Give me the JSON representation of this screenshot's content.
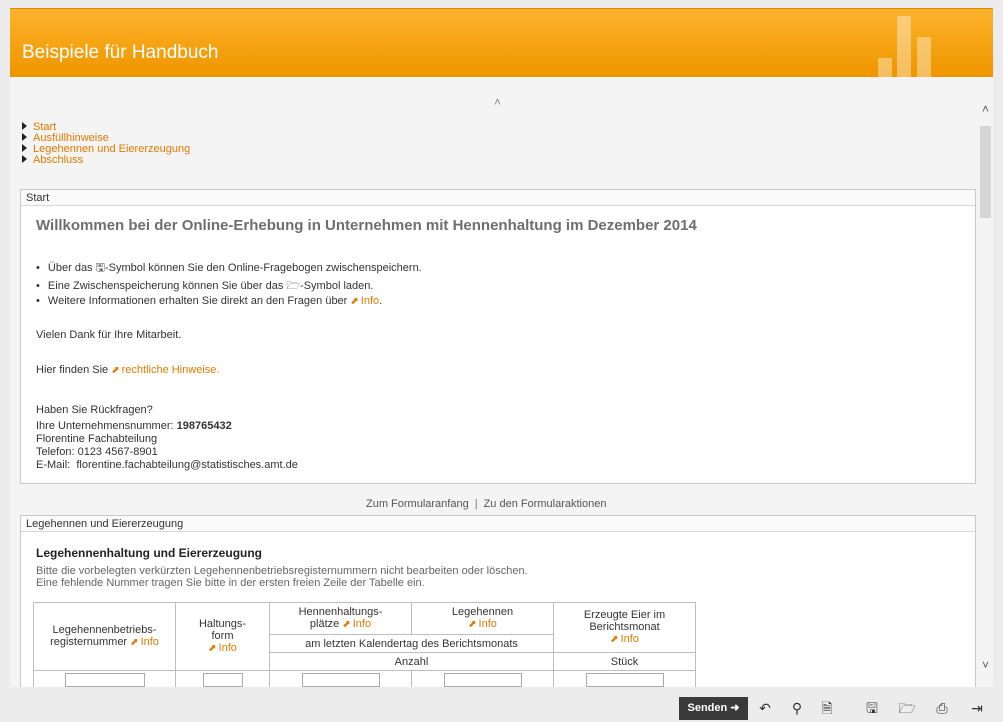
{
  "header": {
    "title": "Beispiele für Handbuch"
  },
  "scroll": {
    "up_glyph": "˄",
    "down_glyph": "˅",
    "top_caret": "˄"
  },
  "nav": {
    "items": [
      "Start",
      "Ausfüllhinweise",
      "Legehennen und Eiererzeugung",
      "Abschluss"
    ]
  },
  "start_panel": {
    "header": "Start",
    "welcome": "Willkommen bei der Online-Erhebung in Unternehmen mit Hennenhaltung im Dezember 2014",
    "bullet1_pre": "Über das ",
    "bullet1_post": "-Symbol können Sie den Online-Fragebogen zwischenspeichern.",
    "bullet2_pre": "Eine Zwischenspeicherung können Sie über das ",
    "bullet2_post": "-Symbol laden.",
    "bullet3_pre": "Weitere Informationen erhalten Sie direkt an den Fragen über ",
    "bullet3_link": "Info",
    "bullet3_post": ".",
    "thanks": "Vielen Dank für Ihre Mitarbeit.",
    "legal_pre": "Hier finden Sie ",
    "legal_link": "rechtliche Hinweise.",
    "questions": "Haben Sie Rückfragen?",
    "company_label": "Ihre Unternehmensnummer:",
    "company_number": "198765432",
    "contact_name": "Florentine Fachabteilung",
    "phone": "Telefon: 0123 4567-8901",
    "email_label": "E-Mail:",
    "email": "florentine.fachabteilung@statistisches.amt.de"
  },
  "mid_links": {
    "first": "Zum Formularanfang",
    "second": "Zu den Formularaktionen"
  },
  "section_panel": {
    "header": "Legehennen und Eiererzeugung",
    "title": "Legehennenhaltung und Eiererzeugung",
    "note1": "Bitte die vorbelegten verkürzten Legehennenbetriebsregisternummern nicht bearbeiten oder löschen.",
    "note2": "Eine fehlende Nummer tragen Sie bitte in der ersten freien Zeile der Tabelle ein."
  },
  "table": {
    "col1_line1": "Legehennenbetriebs-",
    "col1_line2": "registernummer",
    "col2_line1": "Haltungs-",
    "col2_line2": "form",
    "col3_line1": "Hennenhaltungs-",
    "col3_line2": "plätze",
    "col4": "Legehennen",
    "col5_line1": "Erzeugte Eier im",
    "col5_line2": "Berichtsmonat",
    "info": "Info",
    "subhead": "am letzten Kalendertag des Berichtsmonats",
    "unit_count": "Anzahl",
    "unit_piece": "Stück"
  },
  "toolbar": {
    "send_label": "Senden ➜",
    "icons": [
      "undo-icon",
      "search-icon",
      "pdf-icon",
      "save-icon",
      "open-folder-icon",
      "print-icon",
      "exit-icon"
    ]
  }
}
